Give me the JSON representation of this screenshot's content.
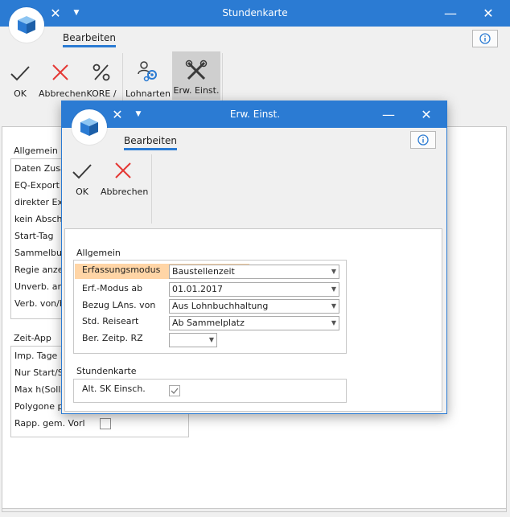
{
  "main": {
    "title": "Stundenkarte",
    "tab": "Bearbeiten",
    "toolbar": [
      {
        "label": "OK",
        "icon": "check-icon"
      },
      {
        "label": "Abbrechen",
        "icon": "cross-icon"
      },
      {
        "label": "KORE / ARGE",
        "icon": "percent-icon"
      },
      {
        "label": "Lohnarten",
        "icon": "users-gear-icon"
      },
      {
        "label": "Erw. Einst.",
        "icon": "tools-icon"
      }
    ],
    "groups": {
      "allgemein": {
        "title": "Allgemein",
        "rows": [
          "Daten Zusammenfassen",
          "EQ-Export",
          "direkter Export",
          "kein Abschluss",
          "Start-Tag",
          "Sammelbuchung",
          "Regie anzeigen",
          "Unverb. archivieren",
          "Verb. von/bis"
        ]
      },
      "zeitapp": {
        "title": "Zeit-App",
        "rows": [
          "Imp. Tage Liste",
          "Nur Start/Stop",
          "Max h(Sollz.)",
          "Polygone prüfen",
          "Rapp. gem. Vorl"
        ]
      }
    }
  },
  "dialog": {
    "title": "Erw. Einst.",
    "tab": "Bearbeiten",
    "toolbar": [
      {
        "label": "OK",
        "icon": "check-icon"
      },
      {
        "label": "Abbrechen",
        "icon": "cross-icon"
      }
    ],
    "allgemein": {
      "title": "Allgemein",
      "fields": [
        {
          "label": "Erfassungsmodus",
          "value": "Baustellenzeit"
        },
        {
          "label": "Erf.-Modus ab",
          "value": "01.01.2017"
        },
        {
          "label": "Bezug LAns. von",
          "value": "Aus Lohnbuchhaltung"
        },
        {
          "label": "Std. Reiseart",
          "value": "Ab Sammelplatz"
        },
        {
          "label": "Ber. Zeitp. RZ",
          "value": ""
        }
      ]
    },
    "stundenkarte": {
      "title": "Stundenkarte",
      "fields": [
        {
          "label": "Alt. SK Einsch.",
          "checked": true
        }
      ]
    }
  },
  "colors": {
    "accent": "#2b7bd3",
    "highlight": "#ffd5a6",
    "cancel": "#e53935"
  }
}
